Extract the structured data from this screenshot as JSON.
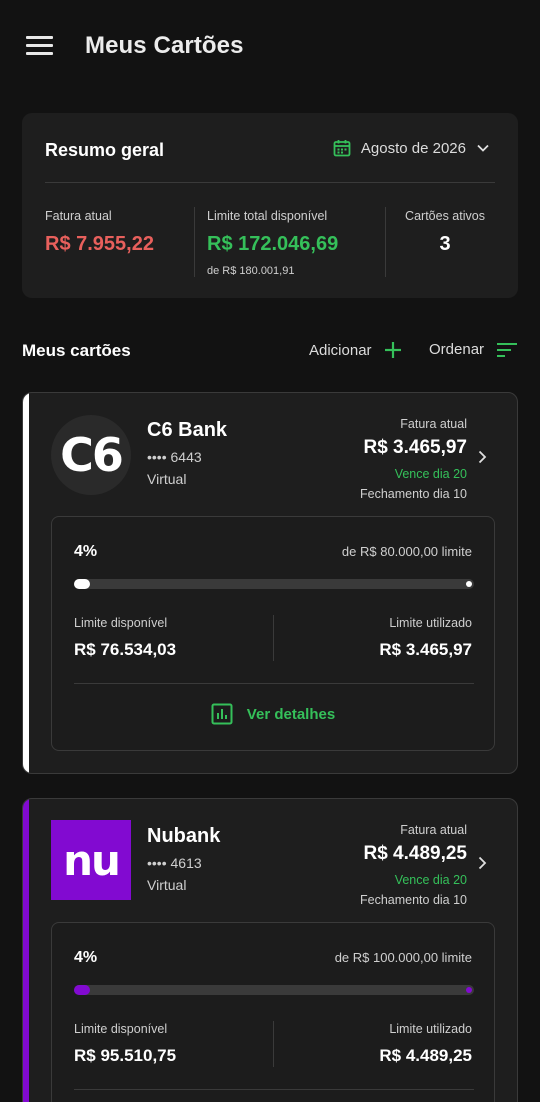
{
  "appbar": {
    "title": "Meus Cartões",
    "menu_icon": "hamburger-menu-icon"
  },
  "summary": {
    "title": "Resumo geral",
    "month": "Agosto de 2026",
    "calendar_icon": "calendar-icon",
    "current_bill_label": "Fatura atual",
    "current_bill_value": "R$ 7.955,22",
    "available_limit_label": "Limite total disponível",
    "available_limit_value": "R$ 172.046,69",
    "available_limit_sub": "de R$ 180.001,91",
    "active_cards_label": "Cartões ativos",
    "active_cards_value": "3"
  },
  "cards_section": {
    "title": "Meus cartões",
    "add_label": "Adicionar",
    "sort_label": "Ordenar"
  },
  "cards": [
    {
      "bank": "C6 Bank",
      "logo_text": "C6",
      "number": "•••• 6443",
      "type": "Virtual",
      "bill_label": "Fatura atual",
      "bill_value": "R$ 3.465,97",
      "due": "Vence dia 20",
      "closing": "Fechamento dia 10",
      "percent": "4%",
      "usage_fraction": 0.04,
      "of_limit": "de R$ 80.000,00 limite",
      "available_label": "Limite disponível",
      "available_value": "R$ 76.534,03",
      "used_label": "Limite utilizado",
      "used_value": "R$ 3.465,97",
      "details_label": "Ver detalhes",
      "accent": "#ffffff"
    },
    {
      "bank": "Nubank",
      "logo_text": "nu",
      "number": "•••• 4613",
      "type": "Virtual",
      "bill_label": "Fatura atual",
      "bill_value": "R$ 4.489,25",
      "due": "Vence dia 20",
      "closing": "Fechamento dia 10",
      "percent": "4%",
      "usage_fraction": 0.04,
      "of_limit": "de R$ 100.000,00 limite",
      "available_label": "Limite disponível",
      "available_value": "R$ 95.510,75",
      "used_label": "Limite utilizado",
      "used_value": "R$ 4.489,25",
      "accent": "#820ad1"
    }
  ],
  "colors": {
    "background": "#121212",
    "surface": "#1e1e1e",
    "negative": "#e8605c",
    "positive": "#35c05a",
    "nubank_purple": "#820ad1"
  }
}
